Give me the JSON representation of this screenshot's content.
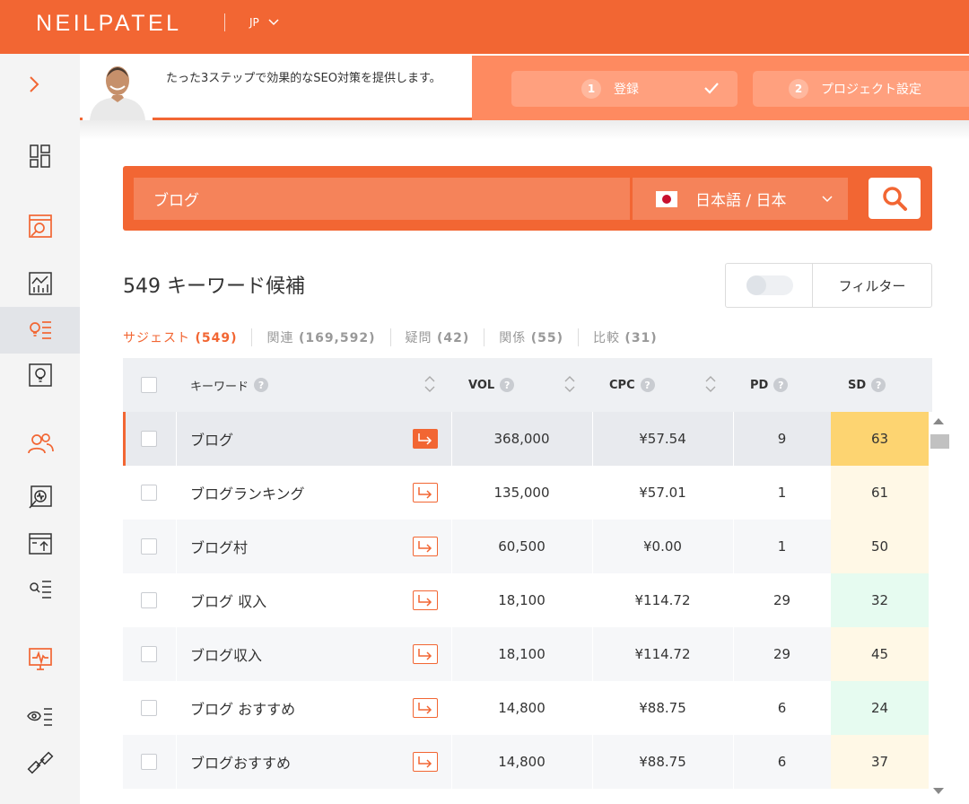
{
  "header": {
    "logo": "NEILPATEL",
    "language": "JP"
  },
  "sidebar": {
    "toggle_icon": "chevron-right-icon",
    "items": [
      {
        "icon": "dashboard-icon",
        "active": false
      },
      {
        "icon": "site-audit-icon",
        "active": false
      },
      {
        "icon": "traffic-analytics-icon",
        "active": false
      },
      {
        "icon": "keyword-ideas-icon",
        "active": true
      },
      {
        "icon": "content-ideas-icon",
        "active": false
      },
      {
        "icon": "competitors-icon",
        "active": false
      },
      {
        "icon": "rank-tracking-icon",
        "active": false
      },
      {
        "icon": "traffic-upload-icon",
        "active": false
      },
      {
        "icon": "keyword-list-icon",
        "active": false
      },
      {
        "icon": "site-monitor-icon",
        "active": false
      },
      {
        "icon": "visibility-icon",
        "active": false
      },
      {
        "icon": "backlinks-icon",
        "active": false
      }
    ]
  },
  "banner": {
    "text": "たった3ステップで効果的なSEO対策を提供します。",
    "steps": [
      {
        "number": "1",
        "label": "登録"
      },
      {
        "number": "2",
        "label": "プロジェクト設定"
      }
    ]
  },
  "search": {
    "query": "ブログ",
    "language_option": "日本語 / 日本"
  },
  "results": {
    "title": "549 キーワード候補",
    "filter_label": "フィルター",
    "tabs": [
      {
        "label": "サジェスト",
        "count": "(549)",
        "active": true
      },
      {
        "label": "関連",
        "count": "(169,592)",
        "active": false
      },
      {
        "label": "疑問",
        "count": "(42)",
        "active": false
      },
      {
        "label": "関係",
        "count": "(55)",
        "active": false
      },
      {
        "label": "比較",
        "count": "(31)",
        "active": false
      }
    ]
  },
  "table": {
    "columns": {
      "keyword": "キーワード",
      "vol": "VOL",
      "cpc": "CPC",
      "pd": "PD",
      "sd": "SD"
    },
    "help_symbol": "?",
    "rows": [
      {
        "keyword": "ブログ",
        "vol": "368,000",
        "cpc": "¥57.54",
        "pd": "9",
        "sd": "63",
        "sd_color": "#fdd471",
        "selected": true
      },
      {
        "keyword": "ブログランキング",
        "vol": "135,000",
        "cpc": "¥57.01",
        "pd": "1",
        "sd": "61",
        "sd_color": "#fff8e6",
        "selected": false
      },
      {
        "keyword": "ブログ村",
        "vol": "60,500",
        "cpc": "¥0.00",
        "pd": "1",
        "sd": "50",
        "sd_color": "#fff8e6",
        "selected": false
      },
      {
        "keyword": "ブログ 収入",
        "vol": "18,100",
        "cpc": "¥114.72",
        "pd": "29",
        "sd": "32",
        "sd_color": "#e6fbf0",
        "selected": false
      },
      {
        "keyword": "ブログ収入",
        "vol": "18,100",
        "cpc": "¥114.72",
        "pd": "29",
        "sd": "45",
        "sd_color": "#fff8e6",
        "selected": false
      },
      {
        "keyword": "ブログ おすすめ",
        "vol": "14,800",
        "cpc": "¥88.75",
        "pd": "6",
        "sd": "24",
        "sd_color": "#e6fbf0",
        "selected": false
      },
      {
        "keyword": "ブログおすすめ",
        "vol": "14,800",
        "cpc": "¥88.75",
        "pd": "6",
        "sd": "37",
        "sd_color": "#fff8e6",
        "selected": false
      }
    ]
  },
  "colors": {
    "brand": "#f26633",
    "banner_light": "#fe8a60"
  }
}
